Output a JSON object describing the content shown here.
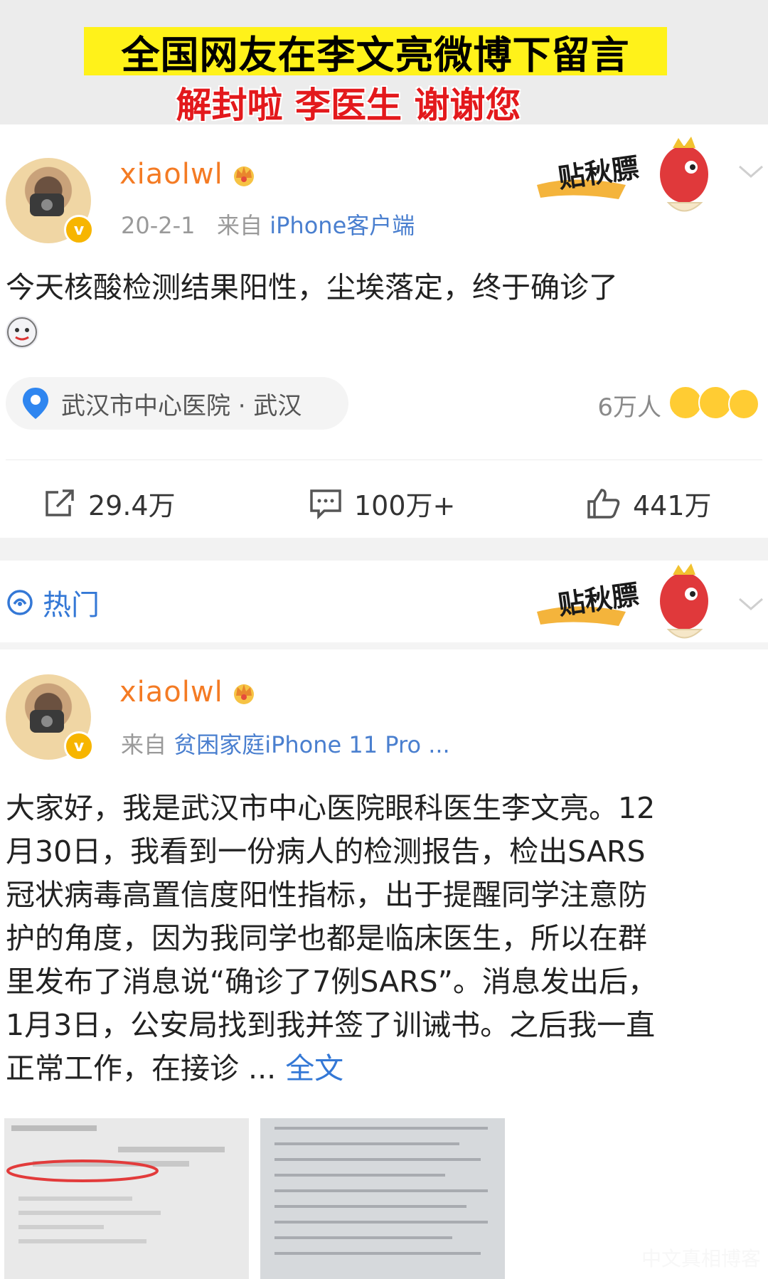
{
  "banner": {
    "title": "全国网友在李文亮微博下留言",
    "subtitle": "解封啦 李医生 谢谢您"
  },
  "post1": {
    "username": "xiaolwl",
    "date": "20-2-1",
    "from_prefix": "来自",
    "source": "iPhone客户端",
    "text": "今天核酸检测结果阳性，尘埃落定，终于确诊了",
    "location": "武汉市中心医院 · 武汉",
    "reach": "6万人",
    "sticker_text": "贴秋膘",
    "actions": {
      "repost": "29.4万",
      "comment": "100万+",
      "like": "441万"
    }
  },
  "hot": {
    "label": "热门",
    "sticker_text": "贴秋膘"
  },
  "post2": {
    "username": "xiaolwl",
    "from_prefix": "来自",
    "source": "贫困家庭iPhone 11 Pro ...",
    "lines": [
      "大家好，我是武汉市中心医院眼科医生李文亮。12",
      "月30日，我看到一份病人的检测报告，检出SARS",
      "冠状病毒高置信度阳性指标，出于提醒同学注意防",
      "护的角度，因为我同学也都是临床医生，所以在群",
      "里发布了消息说“确诊了7例SARS”。消息发出后，",
      "1月3日，公安局找到我并签了训诫书。之后我一直"
    ],
    "last_line": "正常工作，在接诊 ...",
    "full_text_link": "全文"
  },
  "colors": {
    "banner_yellow": "#fff21a",
    "banner_red": "#e3191c",
    "username_orange": "#f47b24",
    "link_blue": "#3478d6"
  },
  "icons": [
    "crown-icon",
    "verified-icon",
    "location-pin-icon",
    "repost-icon",
    "comment-icon",
    "like-icon",
    "hot-icon",
    "chevron-down-icon"
  ],
  "watermark": "中文真相博客"
}
